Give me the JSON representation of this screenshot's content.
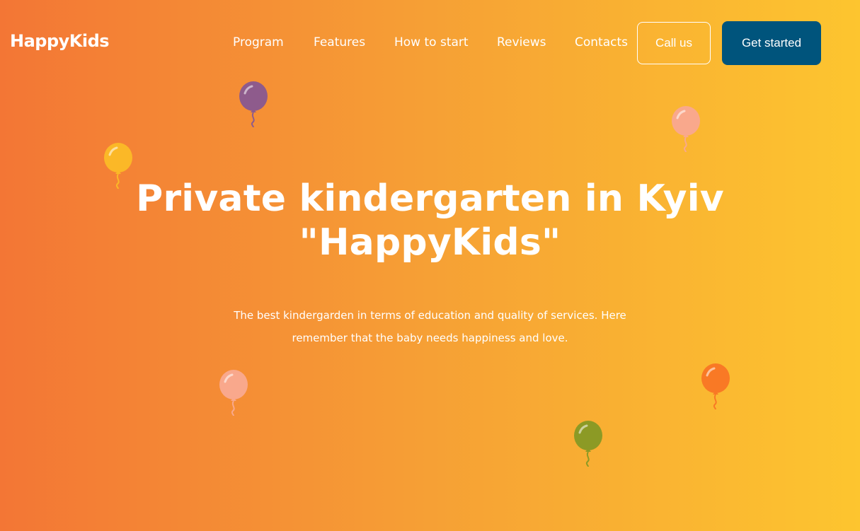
{
  "header": {
    "logo": "HappyKids",
    "nav": [
      "Program",
      "Features",
      "How to start",
      "Reviews",
      "Contacts"
    ],
    "call_label": "Call us",
    "start_label": "Get started"
  },
  "hero": {
    "title_line1": "Private kindergarten in Kyiv",
    "title_line2": "\"HappyKids\"",
    "subtitle_line1": "The best kindergarden in terms of education and quality of services. Here",
    "subtitle_line2": "remember that the baby needs happiness and love."
  },
  "colors": {
    "gradient_start": "#f37635",
    "gradient_end": "#fdc52f",
    "button_primary": "#00547c",
    "balloons": [
      "#8e5b8c",
      "#f9a88c",
      "#fbb827",
      "#f9a88c",
      "#f97925",
      "#8c9a25"
    ]
  }
}
